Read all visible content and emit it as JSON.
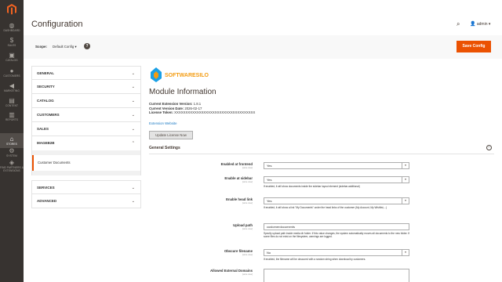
{
  "sidebar": {
    "items": [
      {
        "label": "DASHBOARD",
        "icon": "dashboard-icon",
        "glyph": "◍"
      },
      {
        "label": "SALES",
        "icon": "dollar-icon",
        "glyph": "$"
      },
      {
        "label": "CATALOG",
        "icon": "cube-icon",
        "glyph": "▣"
      },
      {
        "label": "CUSTOMERS",
        "icon": "customers-icon",
        "glyph": "●"
      },
      {
        "label": "MARKETING",
        "icon": "megaphone-icon",
        "glyph": "◀"
      },
      {
        "label": "CONTENT",
        "icon": "content-icon",
        "glyph": "▤"
      },
      {
        "label": "REPORTS",
        "icon": "reports-icon",
        "glyph": "▥"
      },
      {
        "label": "STORES",
        "icon": "stores-icon",
        "glyph": "⌂"
      },
      {
        "label": "SYSTEM",
        "icon": "gear-icon",
        "glyph": "⚙"
      },
      {
        "label": "FIND PARTNERS & EXTENSIONS",
        "icon": "puzzle-icon",
        "glyph": "◈"
      }
    ]
  },
  "header": {
    "title": "Configuration",
    "user": "admin ▾"
  },
  "scope": {
    "label": "Scope:",
    "value": "Default Config ▾",
    "help": "?",
    "save_label": "Save Config"
  },
  "tabs": [
    {
      "label": "GENERAL"
    },
    {
      "label": "SECURITY"
    },
    {
      "label": "CATALOG"
    },
    {
      "label": "CUSTOMERS"
    },
    {
      "label": "SALES"
    },
    {
      "label": "MAGEB2B"
    }
  ],
  "subitem": "Customer Documents",
  "tabs_after": [
    {
      "label": "SERVICES"
    },
    {
      "label": "ADVANCED"
    }
  ],
  "brand": {
    "name": "SOFTWARESILO"
  },
  "module": {
    "title": "Module Information",
    "version_label": "Current Extension Version:",
    "version": "1.8.1",
    "date_label": "Current Version Date:",
    "date": "2026-02-17",
    "token_label": "License Token:",
    "token": "XXXXXXXXXXXXXXXXXXXXXXXXXXXXXXXXXXXX",
    "ext_link": "Extension Website",
    "update_btn": "Update License Now"
  },
  "general_settings": {
    "title": "General Settings",
    "toggle": "⊖",
    "store_view": "[store view]",
    "fields": [
      {
        "label": "Enabled at frontend",
        "value": "Yes",
        "type": "select",
        "note": ""
      },
      {
        "label": "Enable at sidebar",
        "value": "Yes",
        "type": "select",
        "note": "If enabled, it will show documents inside the sidebar layout element (sidebar.additional)"
      },
      {
        "label": "Enable head link",
        "value": "Yes",
        "type": "select",
        "note": "If enabled, it will show a link \"My Documents\" under the head links of the customer (My Account, My Wishlist,...)"
      },
      {
        "label": "Upload path",
        "value": "customerdocuments",
        "type": "input",
        "note": "Specify upload path inside media dir folder. If this value changes, the system automatically moves all documents to the new folder. If some files do not exist on the filesystem, warnings are logged."
      },
      {
        "label": "Obscure filename",
        "value": "No",
        "type": "select",
        "note": "If enabled, the filename will be obscured with a random string when download by customers."
      },
      {
        "label": "Allowed External Domains",
        "value": "",
        "type": "textarea",
        "note": ""
      }
    ]
  },
  "colors": {
    "accent": "#eb5202",
    "sidebar": "#373330",
    "link": "#1979c3"
  }
}
